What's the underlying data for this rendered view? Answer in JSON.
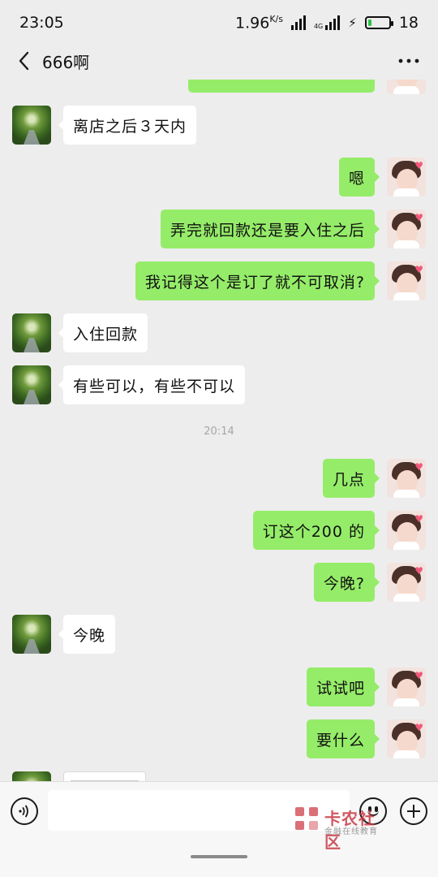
{
  "status_bar": {
    "time": "23:05",
    "net_speed": "1.96",
    "net_unit": "K/s",
    "network_type": "4G",
    "battery_level": "18",
    "battery_fill_fraction": 0.18
  },
  "nav": {
    "back_icon": "chevron-left-icon",
    "title": "666啊",
    "more_icon": "more-dots-icon"
  },
  "messages": [
    {
      "side": "in",
      "text": "离店之后３天内"
    },
    {
      "side": "out",
      "text": "嗯"
    },
    {
      "side": "out",
      "text": "弄完就回款还是要入住之后"
    },
    {
      "side": "out",
      "text": "我记得这个是订了就不可取消?"
    },
    {
      "side": "in",
      "text": "入住回款"
    },
    {
      "side": "in",
      "text": "有些可以，有些不可以"
    },
    {
      "side": "out",
      "text": "几点"
    },
    {
      "side": "out",
      "text": "订这个200 的"
    },
    {
      "side": "out",
      "text": "今晚?"
    },
    {
      "side": "in",
      "text": "今晚"
    },
    {
      "side": "out",
      "text": "试试吧"
    },
    {
      "side": "out",
      "text": "要什么"
    }
  ],
  "timestamp": "20:14",
  "input_bar": {
    "voice_icon": "voice-icon",
    "input_value": "",
    "emoji_icon": "emoji-icon",
    "plus_icon": "plus-icon"
  },
  "watermark": {
    "title": "卡农社区",
    "subtitle": "金融在线教育"
  },
  "colors": {
    "outgoing_bubble": "#95ec69",
    "incoming_bubble": "#ffffff",
    "background": "#ededed"
  }
}
